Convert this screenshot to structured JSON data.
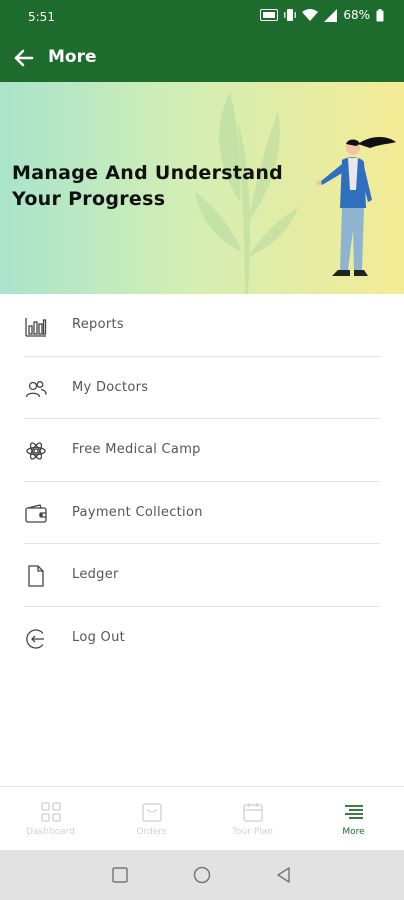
{
  "status_bar": {
    "time": "5:51",
    "battery": "68%"
  },
  "app_bar": {
    "title": "More",
    "back_icon": "arrow-left-icon"
  },
  "banner": {
    "title_line1": "Manage And Understand",
    "title_line2": "Your Progress"
  },
  "menu": {
    "items": [
      {
        "label": "Reports",
        "icon": "bar-chart-icon"
      },
      {
        "label": "My Doctors",
        "icon": "users-icon"
      },
      {
        "label": "Free Medical Camp",
        "icon": "atom-icon"
      },
      {
        "label": "Payment Collection",
        "icon": "wallet-icon"
      },
      {
        "label": "Ledger",
        "icon": "file-icon"
      },
      {
        "label": "Log Out",
        "icon": "logout-icon"
      }
    ]
  },
  "bottom_nav": {
    "items": [
      {
        "label": "Dashboard",
        "icon": "grid-icon"
      },
      {
        "label": "Orders",
        "icon": "shopping-bag-icon"
      },
      {
        "label": "Tour Plan",
        "icon": "calendar-icon"
      },
      {
        "label": "More",
        "icon": "menu-lines-icon"
      }
    ],
    "active": "More"
  },
  "colors": {
    "primary": "#1e6b2e",
    "menu_text": "#555555",
    "divider": "#e3e3e3"
  }
}
